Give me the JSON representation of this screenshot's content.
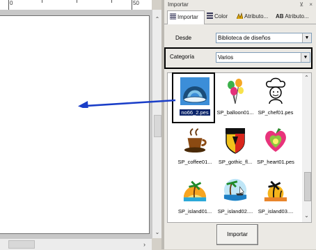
{
  "ruler": {
    "marks": [
      "0",
      "50"
    ]
  },
  "panel": {
    "title": "Importar",
    "pin_glyph": "ᴘ",
    "close_glyph": "×",
    "tabs": [
      {
        "label": "Importar",
        "icon": "grid-icon",
        "active": true
      },
      {
        "label": "Color",
        "icon": "color-list-icon"
      },
      {
        "label": "Atributo...",
        "icon": "stitch-attribute-icon"
      },
      {
        "label": "Atributo...",
        "icon": "text-attribute-icon",
        "prefix": "AB"
      }
    ],
    "desde": {
      "label": "Desde",
      "value": "Biblioteca de diseños"
    },
    "categoria": {
      "label": "Categoría",
      "value": "Varios"
    },
    "designs": [
      {
        "name": "no66_2.pes",
        "selected": true,
        "icon": "rainbow-cloud-icon"
      },
      {
        "name": "SP_balloon01...",
        "icon": "balloons-icon"
      },
      {
        "name": "SP_chef01.pes",
        "icon": "chef-icon"
      },
      {
        "name": "SP_coffee01...",
        "icon": "coffee-cup-icon"
      },
      {
        "name": "SP_gothic_fl...",
        "icon": "shield-icon"
      },
      {
        "name": "SP_heart01.pes",
        "icon": "heart-fruit-icon"
      },
      {
        "name": "SP_island01...",
        "icon": "island-palm-icon"
      },
      {
        "name": "SP_island02....",
        "icon": "island-boat-icon"
      },
      {
        "name": "SP_island03....",
        "icon": "island-sunset-icon"
      }
    ],
    "import_button": "Importar"
  },
  "colors": {
    "accent": "#0a246a",
    "selection_thumb": "#3c8ed8",
    "arrow": "#1a3ec8"
  }
}
